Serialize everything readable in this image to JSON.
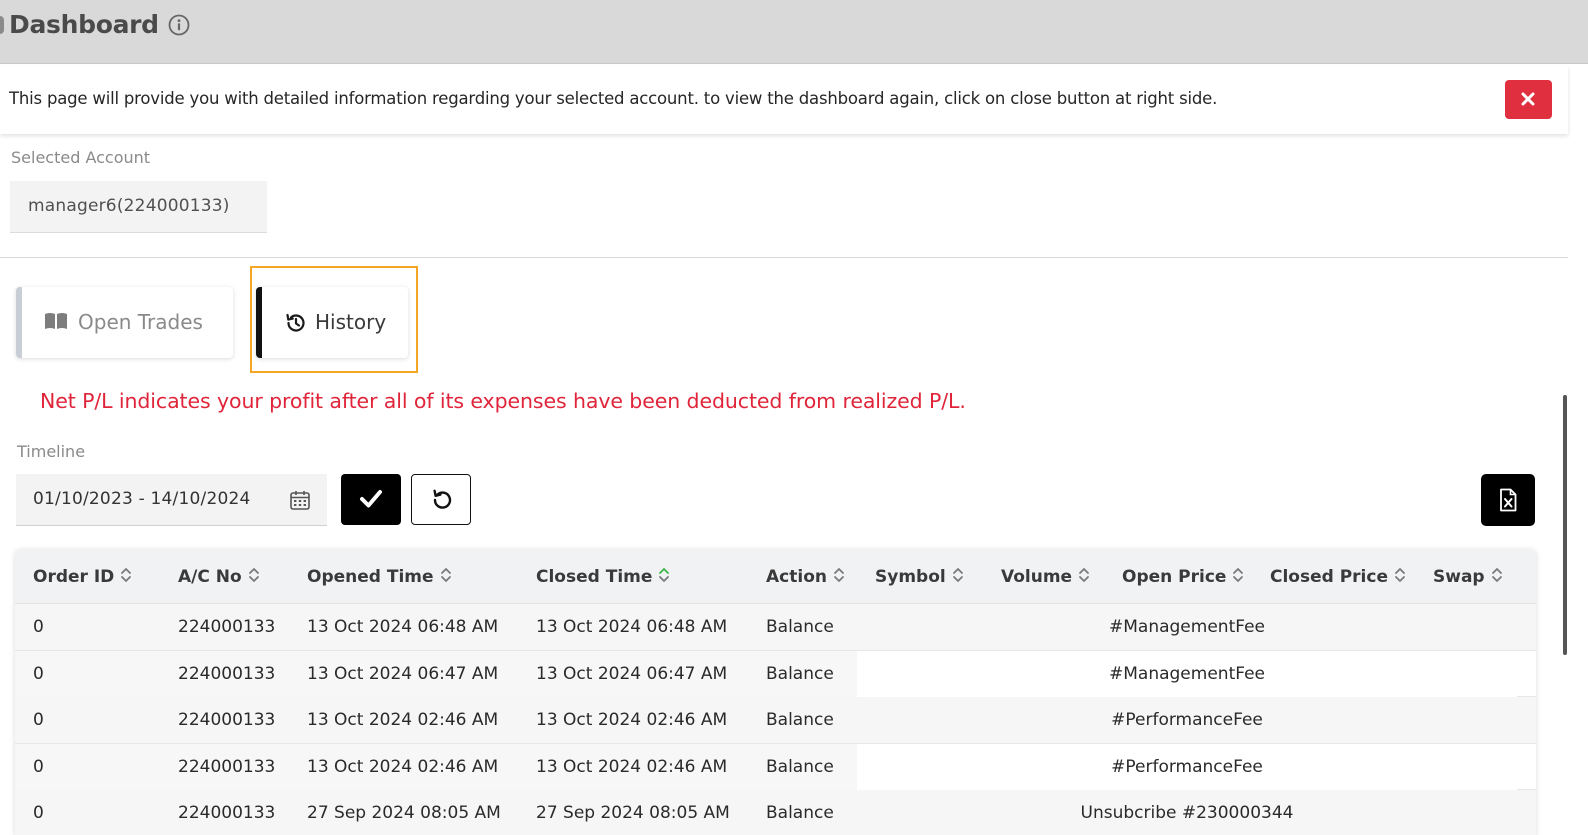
{
  "header": {
    "title": "Dashboard"
  },
  "notice": {
    "text": "This page will provide you with detailed information regarding your selected account. to view the dashboard again, click on close button at right side."
  },
  "account": {
    "label": "Selected Account",
    "value": "manager6(224000133)"
  },
  "tabs": [
    {
      "label": "Open Trades",
      "icon": "book-open-icon",
      "active": false
    },
    {
      "label": "History",
      "icon": "history-icon",
      "active": true
    }
  ],
  "info_message": "Net P/L indicates your profit after all of its expenses have been deducted from realized P/L.",
  "timeline": {
    "label": "Timeline",
    "value": "01/10/2023 - 14/10/2024"
  },
  "table": {
    "columns": [
      "Order ID",
      "A/C No",
      "Opened Time",
      "Closed Time",
      "Action",
      "Symbol",
      "Volume",
      "Open Price",
      "Closed Price",
      "Swap"
    ],
    "sorted_column": "Closed Time",
    "rows": [
      {
        "order_id": "0",
        "ac_no": "224000133",
        "opened": "13 Oct 2024 06:48 AM",
        "closed": "13 Oct 2024 06:48 AM",
        "action": "Balance",
        "comment": "#ManagementFee"
      },
      {
        "order_id": "0",
        "ac_no": "224000133",
        "opened": "13 Oct 2024 06:47 AM",
        "closed": "13 Oct 2024 06:47 AM",
        "action": "Balance",
        "comment": "#ManagementFee"
      },
      {
        "order_id": "0",
        "ac_no": "224000133",
        "opened": "13 Oct 2024 02:46 AM",
        "closed": "13 Oct 2024 02:46 AM",
        "action": "Balance",
        "comment": "#PerformanceFee"
      },
      {
        "order_id": "0",
        "ac_no": "224000133",
        "opened": "13 Oct 2024 02:46 AM",
        "closed": "13 Oct 2024 02:46 AM",
        "action": "Balance",
        "comment": "#PerformanceFee"
      },
      {
        "order_id": "0",
        "ac_no": "224000133",
        "opened": "27 Sep 2024 08:05 AM",
        "closed": "27 Sep 2024 08:05 AM",
        "action": "Balance",
        "comment": "Unsubcribe #230000344"
      }
    ]
  },
  "colors": {
    "danger": "#e0303f",
    "highlight": "#f5a623",
    "sort_active": "#3bb54a"
  }
}
